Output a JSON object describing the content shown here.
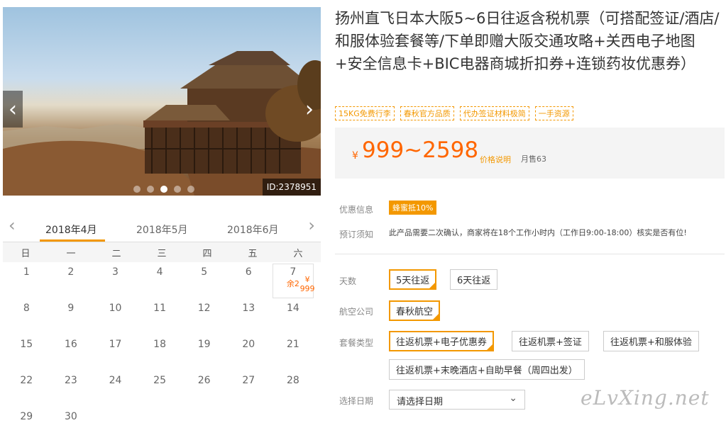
{
  "gallery": {
    "image_id": "ID:2378951",
    "dots": 5,
    "active_dot": 3
  },
  "calendar": {
    "months": [
      "2018年4月",
      "2018年5月",
      "2018年6月"
    ],
    "weekdays": [
      "日",
      "一",
      "二",
      "三",
      "四",
      "五",
      "六"
    ],
    "days": [
      [
        {
          "d": "1"
        },
        {
          "d": "2"
        },
        {
          "d": "3"
        },
        {
          "d": "4"
        },
        {
          "d": "5"
        },
        {
          "d": "6"
        },
        {
          "d": "7",
          "price": "¥ 999",
          "left": "余2"
        }
      ],
      [
        {
          "d": "8"
        },
        {
          "d": "9"
        },
        {
          "d": "10"
        },
        {
          "d": "11"
        },
        {
          "d": "12"
        },
        {
          "d": "13"
        },
        {
          "d": "14"
        }
      ],
      [
        {
          "d": "15"
        },
        {
          "d": "16"
        },
        {
          "d": "17"
        },
        {
          "d": "18"
        },
        {
          "d": "19"
        },
        {
          "d": "20"
        },
        {
          "d": "21"
        }
      ],
      [
        {
          "d": "22"
        },
        {
          "d": "23"
        },
        {
          "d": "24"
        },
        {
          "d": "25"
        },
        {
          "d": "26"
        },
        {
          "d": "27"
        },
        {
          "d": "28"
        }
      ],
      [
        {
          "d": "29"
        },
        {
          "d": "30"
        }
      ]
    ]
  },
  "product": {
    "title": "扬州直飞日本大阪5~6日往返含税机票（可搭配签证/酒店/和服体验套餐等/下单即赠大阪交通攻略+关西电子地图+安全信息卡+BIC电器商城折扣券+连锁药妆优惠券）",
    "tags": [
      "15KG免费行李",
      "春秋官方品质",
      "代办签证材料极简",
      "一手资源"
    ],
    "price_symbol": "¥",
    "price_range": "999~2598",
    "price_note": "价格说明",
    "monthly_sales": "月售63"
  },
  "info": {
    "promo_label": "优惠信息",
    "promo_badge": "蜂蜜抵10%",
    "notice_label": "预订须知",
    "notice_text": "此产品需要二次确认，商家将在18个工作小时内（工作日9:00-18:00）核实是否有位!"
  },
  "options": {
    "days_label": "天数",
    "days": [
      "5天往返",
      "6天往返"
    ],
    "airline_label": "航空公司",
    "airline": [
      "春秋航空"
    ],
    "package_label": "套餐类型",
    "packages": [
      "往返机票+电子优惠券",
      "往返机票+签证",
      "往返机票+和服体验",
      "往返机票+末晚酒店+自助早餐（周四出发）"
    ],
    "date_label": "选择日期",
    "date_placeholder": "请选择日期"
  },
  "watermark": "eLvXing.net",
  "colors": {
    "accent": "#f39800",
    "price": "#ff6600"
  }
}
